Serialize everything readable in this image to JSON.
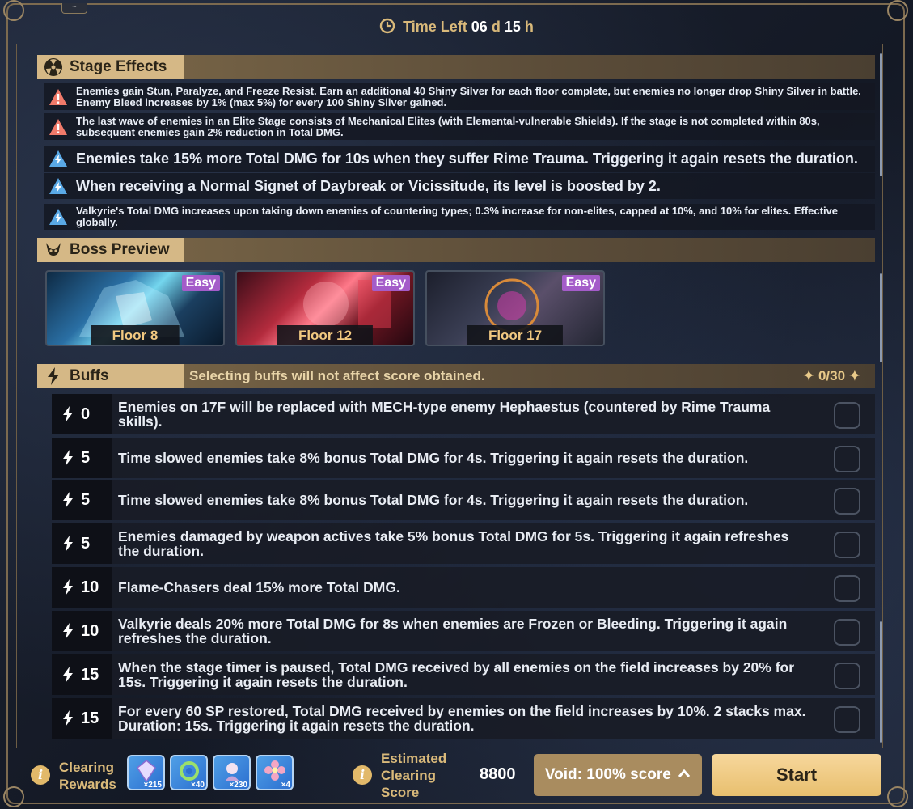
{
  "timer": {
    "label": "Time Left",
    "days": "06",
    "days_unit": "d",
    "hours": "15",
    "hours_unit": "h"
  },
  "stage_effects": {
    "title": "Stage Effects",
    "items": [
      {
        "icon": "warning-red-icon",
        "text": "Enemies gain Stun, Paralyze, and Freeze Resist. Earn an additional 40 Shiny Silver for each floor complete, but enemies no longer drop Shiny Silver in battle. Enemy Bleed increases by 1% (max 5%) for every 100 Shiny Silver gained."
      },
      {
        "icon": "warning-red-icon",
        "text": "The last wave of enemies in an Elite Stage consists of Mechanical Elites (with Elemental-vulnerable Shields). If the stage is not completed within 80s, subsequent enemies gain 2% reduction in Total DMG."
      },
      {
        "icon": "warning-blue-icon",
        "text": "Enemies take 15% more Total DMG for 10s when they suffer Rime Trauma. Triggering it again resets the duration."
      },
      {
        "icon": "warning-blue-icon",
        "text": "When receiving a Normal Signet of Daybreak or Vicissitude, its level is boosted by 2."
      },
      {
        "icon": "warning-blue-icon",
        "text": "Valkyrie's Total DMG increases upon taking down enemies of countering types; 0.3% increase for non-elites, capped at 10%, and 10% for elites. Effective globally."
      }
    ]
  },
  "boss_preview": {
    "title": "Boss Preview",
    "bosses": [
      {
        "difficulty": "Easy",
        "floor": "Floor 8"
      },
      {
        "difficulty": "Easy",
        "floor": "Floor 12"
      },
      {
        "difficulty": "Easy",
        "floor": "Floor 17"
      }
    ]
  },
  "buffs": {
    "title": "Buffs",
    "note": "Selecting buffs will not affect score obtained.",
    "count": "0/30",
    "items": [
      {
        "cost": "0",
        "text": "Enemies on 17F will be replaced with MECH-type enemy Hephaestus (countered by Rime Trauma skills)."
      },
      {
        "cost": "5",
        "text": "Time slowed enemies take 8% bonus Total DMG for 4s. Triggering it again resets the duration."
      },
      {
        "cost": "5",
        "text": "Time slowed enemies take 8% bonus Total DMG for 4s. Triggering it again resets the duration."
      },
      {
        "cost": "5",
        "text": "Enemies damaged by weapon actives take 5% bonus Total DMG for 5s. Triggering it again refreshes the duration."
      },
      {
        "cost": "10",
        "text": "Flame-Chasers deal 15% more Total DMG."
      },
      {
        "cost": "10",
        "text": "Valkyrie deals 20% more Total DMG for 8s when enemies are Frozen or Bleeding. Triggering it again refreshes the duration."
      },
      {
        "cost": "15",
        "text": "When the stage timer is paused, Total DMG received by all enemies on the field increases by 20% for 15s. Triggering it again resets the duration."
      },
      {
        "cost": "15",
        "text": "For every 60 SP restored, Total DMG received by enemies on the field increases by 10%. 2 stacks max. Duration: 15s. Triggering it again resets the duration."
      }
    ]
  },
  "footer": {
    "clearing_rewards_label_1": "Clearing",
    "clearing_rewards_label_2": "Rewards",
    "rewards": [
      {
        "icon": "crystal-reward-icon",
        "qty": "×215"
      },
      {
        "icon": "ring-reward-icon",
        "qty": "×40"
      },
      {
        "icon": "valkyrie-chip-icon",
        "qty": "×230"
      },
      {
        "icon": "flower-reward-icon",
        "qty": "×4"
      }
    ],
    "estimated_label_1": "Estimated",
    "estimated_label_2": "Clearing",
    "estimated_label_3": "Score",
    "score": "8800",
    "void_button": "Void: 100% score",
    "start_button": "Start"
  },
  "colors": {
    "accent_gold": "#d5b886",
    "badge_purple": "#a45cc9",
    "warn_red": "#f07a6a",
    "warn_blue": "#5aa9e6"
  }
}
